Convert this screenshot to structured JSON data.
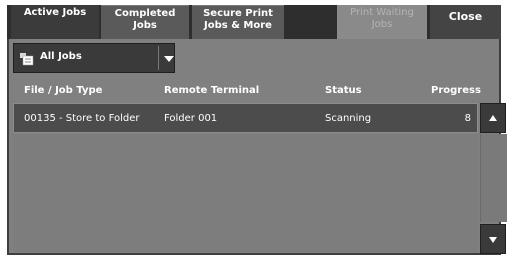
{
  "tabs": {
    "active_jobs": "Active Jobs",
    "completed_jobs": "Completed Jobs",
    "secure_print": "Secure Print Jobs & More",
    "print_waiting": "Print Waiting Jobs",
    "close": "Close"
  },
  "filter": {
    "selected": "All Jobs"
  },
  "columns": {
    "file_job_type": "File / Job Type",
    "remote_terminal": "Remote Terminal",
    "status": "Status",
    "progress": "Progress"
  },
  "rows": [
    {
      "file_job_type": "00135 - Store to Folder",
      "remote_terminal": "Folder 001",
      "status": "Scanning",
      "progress": "8"
    }
  ],
  "icons": {
    "filter": "job-list-icon",
    "dropdown": "chevron-down-icon",
    "scroll_up": "triangle-up-icon",
    "scroll_down": "triangle-down-icon"
  }
}
